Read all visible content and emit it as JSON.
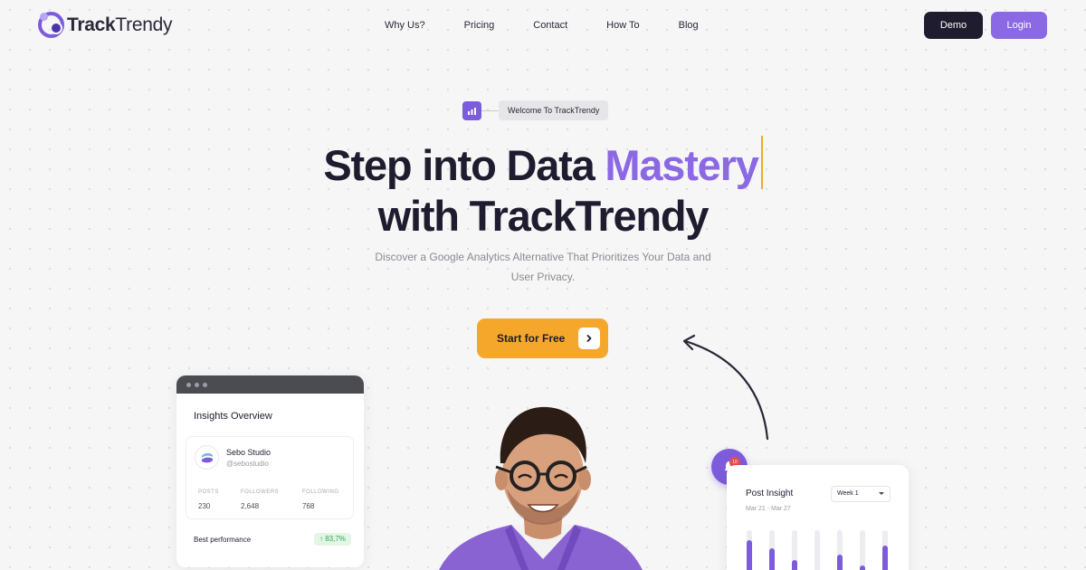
{
  "brand": {
    "name_bold": "Track",
    "name_light": "Trendy"
  },
  "nav": {
    "links": [
      "Why Us?",
      "Pricing",
      "Contact",
      "How To",
      "Blog"
    ],
    "demo_label": "Demo",
    "login_label": "Login"
  },
  "hero": {
    "welcome": "Welcome To TrackTrendy",
    "title_line1_prefix": "Step into Data ",
    "title_line1_accent": "Mastery",
    "title_line2": "with TrackTrendy",
    "subtitle_line1": "Discover a Google Analytics Alternative That Prioritizes Your Data and",
    "subtitle_line2": "User Privacy.",
    "cta_label": "Start for Free"
  },
  "insights_card": {
    "title": "Insights Overview",
    "profile_name": "Sebo Studio",
    "profile_handle": "@sebostudio",
    "stats": [
      {
        "label": "POSTS",
        "value": "230"
      },
      {
        "label": "FOLLOWERS",
        "value": "2,648"
      },
      {
        "label": "FOLLOWING",
        "value": "768"
      }
    ],
    "best_label": "Best performance",
    "best_value": "↑ 83,7%"
  },
  "post_insight": {
    "notification_count": "10",
    "title": "Post Insight",
    "date_range": "Mar 21 - Mar 27",
    "week_select": "Week 1",
    "bars": [
      0.75,
      0.55,
      0.25,
      0.0,
      0.38,
      0.12,
      0.62
    ]
  },
  "colors": {
    "accent_purple": "#8b68e4",
    "cta_orange": "#f5a72c",
    "dark": "#1e1c2e"
  }
}
